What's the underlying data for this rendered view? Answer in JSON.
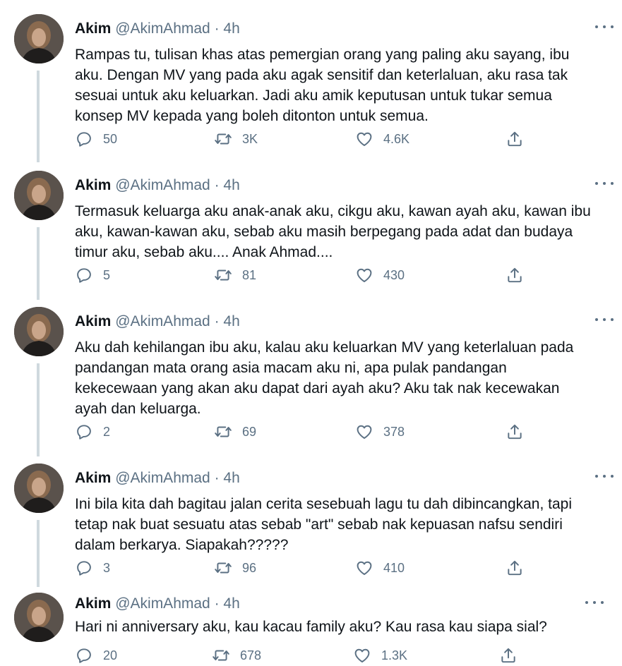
{
  "tweets": [
    {
      "name": "Akim",
      "handle": "@AkimAhmad",
      "separator": "·",
      "time": "4h",
      "text": "Rampas tu, tulisan khas atas pemergian orang yang paling aku sayang, ibu\naku. Dengan MV yang pada aku agak sensitif dan keterlaluan, aku rasa tak\nsesuai untuk aku keluarkan. Jadi aku amik keputusan untuk tukar semua\nkonsep MV kepada yang boleh ditonton untuk semua.",
      "replies": "50",
      "retweets": "3K",
      "likes": "4.6K"
    },
    {
      "name": "Akim",
      "handle": "@AkimAhmad",
      "separator": "·",
      "time": "4h",
      "text": "Termasuk keluarga aku anak-anak aku, cikgu aku, kawan ayah aku, kawan ibu\naku, kawan-kawan aku, sebab aku masih berpegang pada adat dan budaya\ntimur aku, sebab aku.... Anak Ahmad....",
      "replies": "5",
      "retweets": "81",
      "likes": "430"
    },
    {
      "name": "Akim",
      "handle": "@AkimAhmad",
      "separator": "·",
      "time": "4h",
      "text": "Aku dah kehilangan ibu aku, kalau aku keluarkan MV yang keterlaluan pada\npandangan mata orang asia macam aku ni, apa pulak pandangan\nkekecewaan yang akan aku dapat dari ayah aku? Aku tak nak kecewakan\nayah dan keluarga.",
      "replies": "2",
      "retweets": "69",
      "likes": "378"
    },
    {
      "name": "Akim",
      "handle": "@AkimAhmad",
      "separator": "·",
      "time": "4h",
      "text": "Ini bila kita dah bagitau jalan cerita sesebuah lagu tu dah dibincangkan, tapi\ntetap nak buat sesuatu atas sebab \"art\" sebab nak kepuasan nafsu sendiri\ndalam berkarya. Siapakah?????",
      "replies": "3",
      "retweets": "96",
      "likes": "410"
    },
    {
      "name": "Akim",
      "handle": "@AkimAhmad",
      "separator": "·",
      "time": "4h",
      "text": "Hari ni anniversary aku, kau kacau family aku? Kau rasa kau siapa sial?",
      "replies": "20",
      "retweets": "678",
      "likes": "1.3K"
    }
  ],
  "icons": {
    "reply": "reply-icon",
    "retweet": "retweet-icon",
    "like": "heart-icon",
    "share": "share-icon",
    "more": "more-icon"
  },
  "colors": {
    "text": "#0f1419",
    "muted": "#5b7083",
    "thread_line": "#cfd9de"
  }
}
